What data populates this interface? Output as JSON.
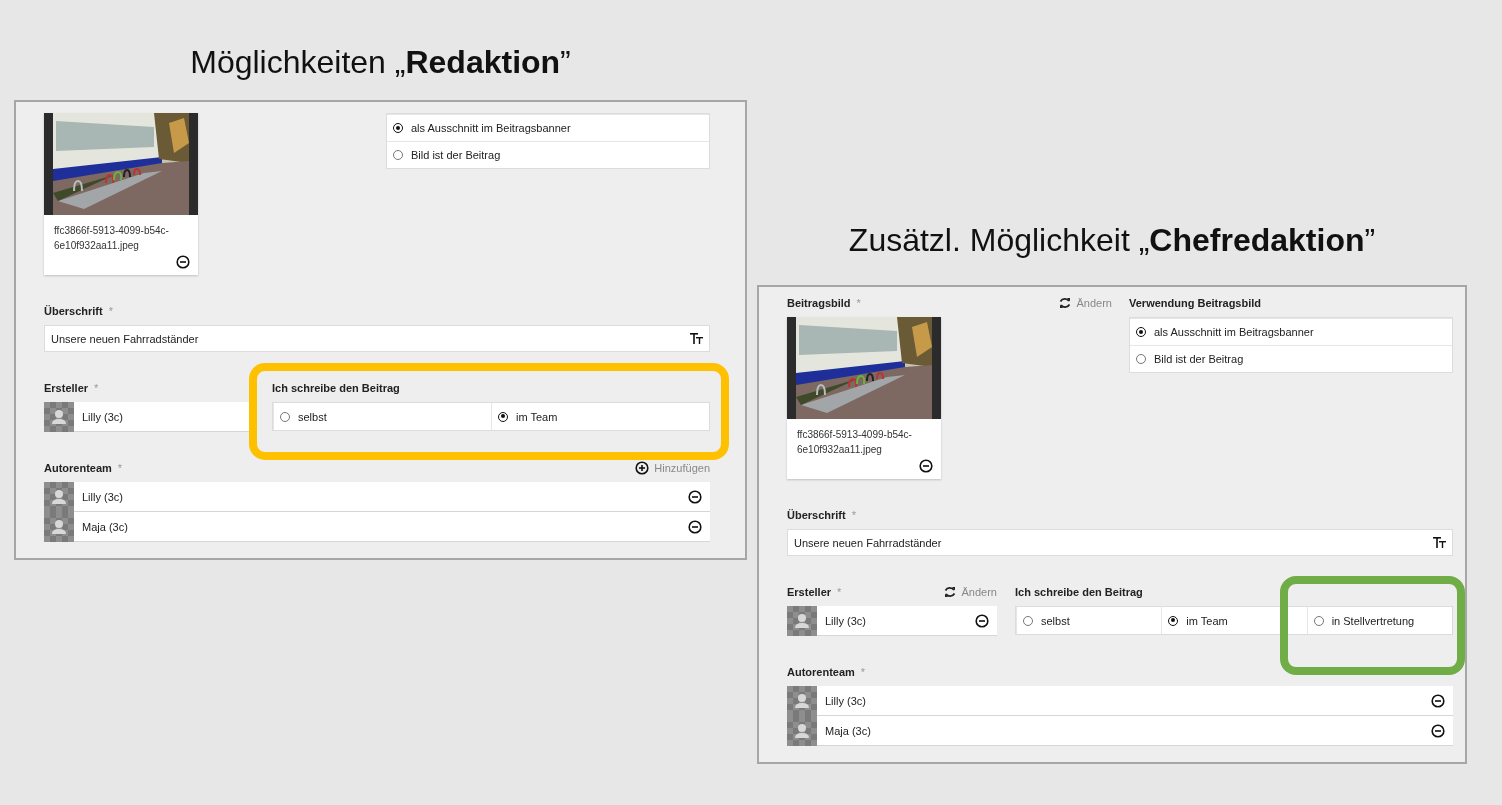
{
  "slide": {
    "panels": [
      {
        "heading": "Möglichkeiten „**Redaktion**”",
        "highlight": {
          "kind": "group",
          "color": "#ffc000"
        },
        "form": {
          "image": {
            "filename": "ffc3866f-5913-4099-b54c-6e10f932aa11.jpeg"
          },
          "usage": {
            "options": [
              {
                "label": "als Ausschnitt im Beitragsbanner",
                "selected": true
              },
              {
                "label": "Bild ist der Beitrag",
                "selected": false
              }
            ]
          },
          "headline": {
            "label": "Überschrift",
            "required_mark": "*",
            "value": "Unsere neuen Fahrradständer"
          },
          "creator": {
            "label": "Ersteller",
            "required_mark": "*",
            "name": "Lilly (3c)",
            "removable": false
          },
          "writing_mode": {
            "label": "Ich schreibe den Beitrag",
            "options": [
              {
                "label": "selbst",
                "selected": false
              },
              {
                "label": "im Team",
                "selected": true
              }
            ]
          },
          "author_team": {
            "label": "Autorenteam",
            "required_mark": "*",
            "add_label": "Hinzufügen",
            "members": [
              {
                "name": "Lilly (3c)"
              },
              {
                "name": "Maja (3c)"
              }
            ]
          }
        }
      },
      {
        "heading": "Zusätzl. Möglichkeit „**Chefredaktion**”",
        "highlight": {
          "kind": "option",
          "color": "#70ad47"
        },
        "form": {
          "image": {
            "label": "Beitragsbild",
            "required_mark": "*",
            "change_label": "Ändern",
            "filename": "ffc3866f-5913-4099-b54c-6e10f932aa11.jpeg"
          },
          "usage": {
            "label": "Verwendung Beitragsbild",
            "options": [
              {
                "label": "als Ausschnitt im Beitragsbanner",
                "selected": true
              },
              {
                "label": "Bild ist der Beitrag",
                "selected": false
              }
            ]
          },
          "headline": {
            "label": "Überschrift",
            "required_mark": "*",
            "value": "Unsere neuen Fahrradständer"
          },
          "creator": {
            "label": "Ersteller",
            "required_mark": "*",
            "change_label": "Ändern",
            "name": "Lilly (3c)",
            "removable": true
          },
          "writing_mode": {
            "label": "Ich schreibe den Beitrag",
            "options": [
              {
                "label": "selbst",
                "selected": false
              },
              {
                "label": "im Team",
                "selected": true
              },
              {
                "label": "in Stellvertretung",
                "selected": false
              }
            ]
          },
          "author_team": {
            "label": "Autorenteam",
            "required_mark": "*",
            "members": [
              {
                "name": "Lilly (3c)"
              },
              {
                "name": "Maja (3c)"
              }
            ]
          }
        }
      }
    ]
  }
}
